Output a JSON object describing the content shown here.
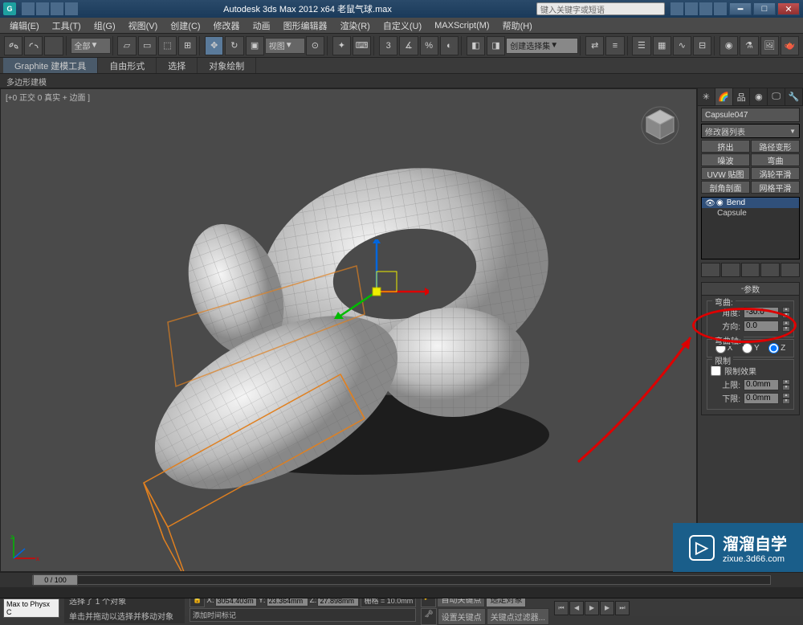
{
  "app": {
    "title": "Autodesk 3ds Max 2012 x64    老鼠气球.max",
    "search_placeholder": "键入关键字或短语"
  },
  "menu": [
    "编辑(E)",
    "工具(T)",
    "组(G)",
    "视图(V)",
    "创建(C)",
    "修改器",
    "动画",
    "图形编辑器",
    "渲染(R)",
    "自定义(U)",
    "MAXScript(M)",
    "帮助(H)"
  ],
  "toolbar": {
    "layers": "全部",
    "viewmode": "视图",
    "selection_set": "创建选择集"
  },
  "ribbon": {
    "tabs": [
      "Graphite 建模工具",
      "自由形式",
      "选择",
      "对象绘制"
    ],
    "sub": "多边形建模"
  },
  "viewport": {
    "label": "[+0 正交 0 真实 + 边面 ]"
  },
  "cmdpanel": {
    "object_name": "Capsule047",
    "modifier_list_label": "修改器列表",
    "buttons": [
      [
        "挤出",
        "路径变形"
      ],
      [
        "噪波",
        "弯曲"
      ],
      [
        "UVW 贴图",
        "涡轮平滑"
      ],
      [
        "剖角剖面",
        "网格平滑"
      ]
    ],
    "stack": [
      "Bend",
      "Capsule"
    ]
  },
  "parameters": {
    "title": "参数",
    "bend_label": "弯曲:",
    "angle_label": "角度:",
    "angle_value": "-30.0",
    "direction_label": "方向:",
    "direction_value": "0.0",
    "axis_label": "弯曲轴:",
    "axes": [
      "X",
      "Y",
      "Z"
    ],
    "axis_selected": "Z",
    "limit_label": "限制",
    "limit_effect": "限制效果",
    "upper_label": "上限:",
    "upper_value": "0.0mm",
    "lower_label": "下限:",
    "lower_value": "0.0mm"
  },
  "status": {
    "time_slider": "0 / 100",
    "selection": "选择了 1 个对象",
    "prompt": "单击并拖动以选择并移动对象",
    "x": "3054.403m",
    "y": "23.364mm",
    "z": "27.898mm",
    "grid": "栅格 = 10.0mm",
    "auto_key": "自动关键点",
    "set_key": "设置关键点",
    "selected_obj": "选定对象",
    "add_time_tag": "添加时间标记",
    "key_filters": "关键点过滤器...",
    "script_label": "Max to Physx C"
  },
  "watermark": {
    "title": "溜溜自学",
    "url": "zixue.3d66.com"
  }
}
